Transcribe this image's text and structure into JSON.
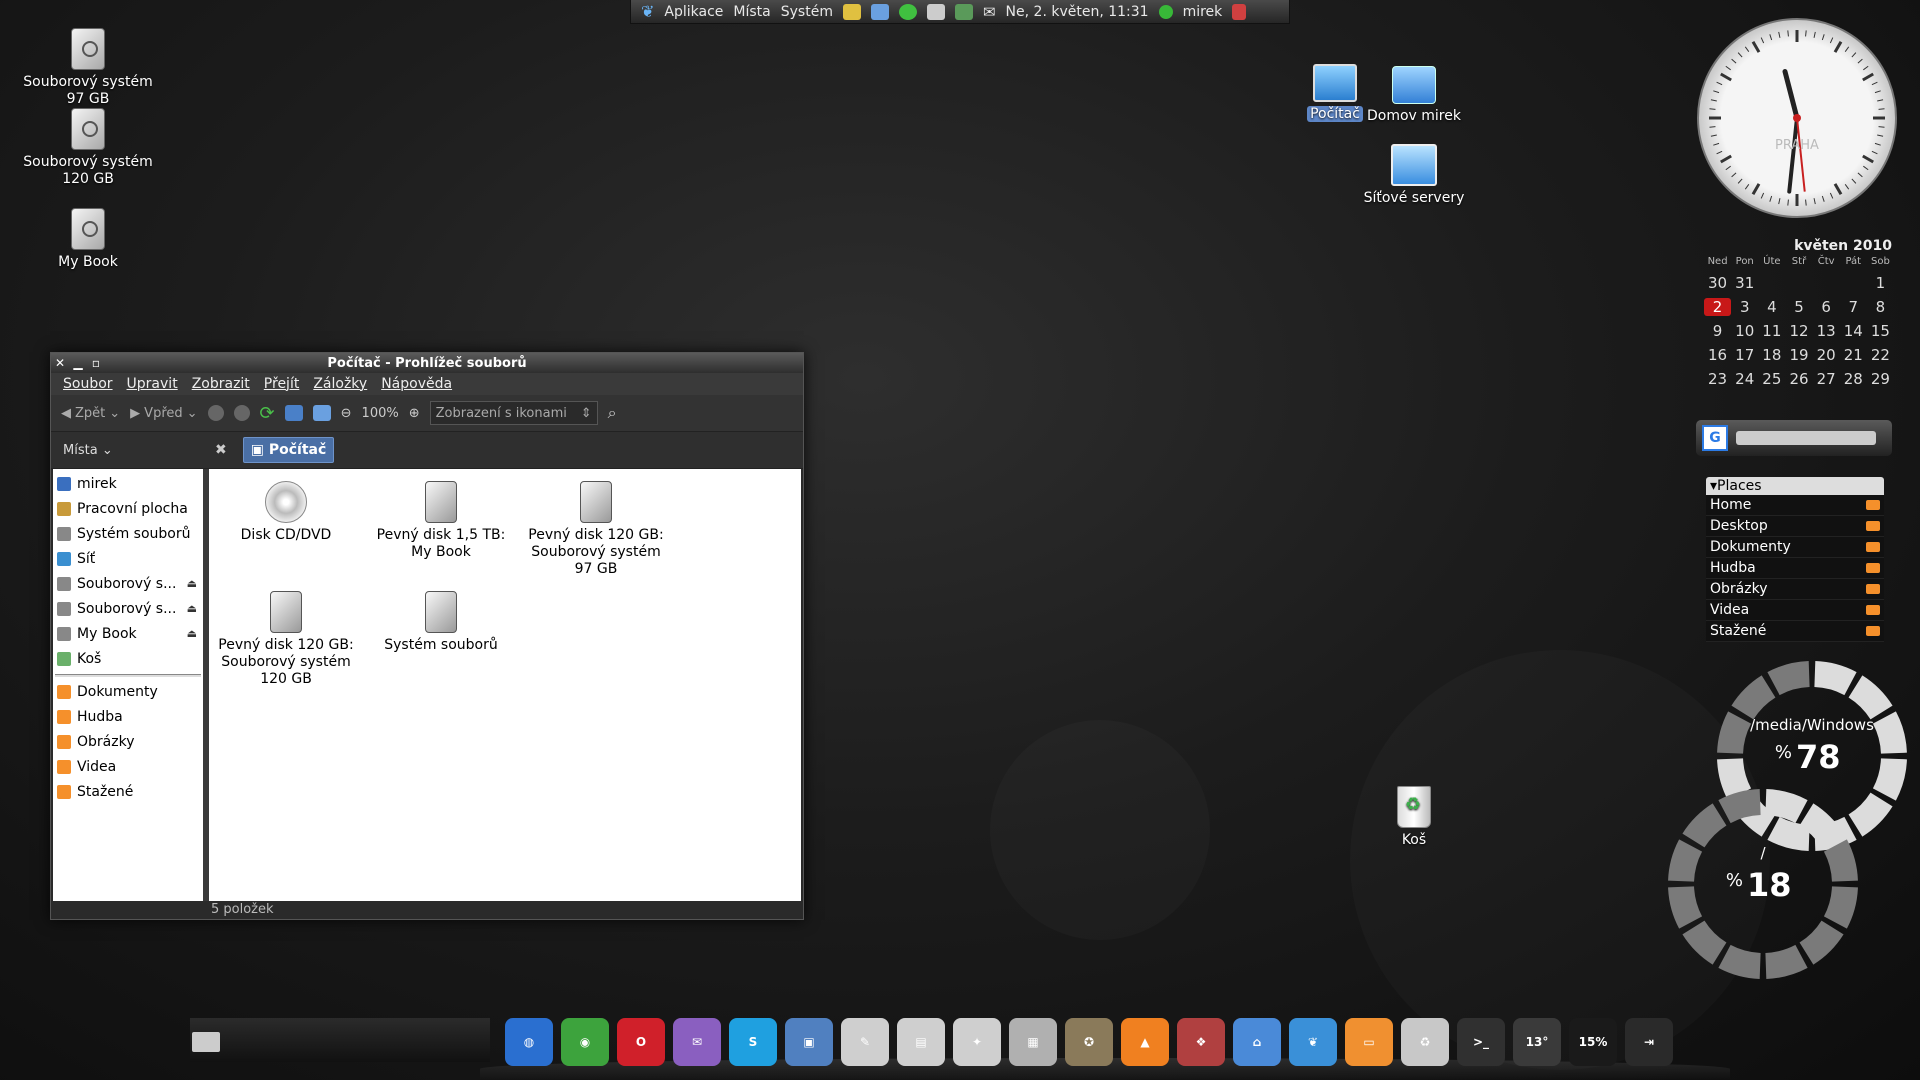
{
  "top_panel": {
    "apps": "Aplikace",
    "places": "Místa",
    "system": "Systém",
    "datetime": "Ne,  2. květen, 11:31",
    "user": "mirek"
  },
  "desktop_icons": [
    {
      "label": "Souborový systém\n97 GB"
    },
    {
      "label": "Souborový systém\n120 GB"
    },
    {
      "label": "My Book"
    },
    {
      "label": "Počítač"
    },
    {
      "label": "Domov mirek"
    },
    {
      "label": "Síťové servery"
    },
    {
      "label": "Koš"
    }
  ],
  "file_manager": {
    "title": "Počítač - Prohlížeč souborů",
    "menu": [
      "Soubor",
      "Upravit",
      "Zobrazit",
      "Přejít",
      "Záložky",
      "Nápověda"
    ],
    "toolbar": {
      "back": "Zpět",
      "forward": "Vpřed",
      "zoom": "100%",
      "view_mode": "Zobrazení s ikonami"
    },
    "places_label": "Místa",
    "location": "Počítač",
    "sidebar": [
      {
        "label": "mirek",
        "color": "#3a6fbf"
      },
      {
        "label": "Pracovní plocha",
        "color": "#c89a3a"
      },
      {
        "label": "Systém souborů",
        "color": "#888888"
      },
      {
        "label": "Síť",
        "color": "#3a8fd0"
      },
      {
        "label": "Souborový s...",
        "color": "#888888"
      },
      {
        "label": "Souborový s...",
        "color": "#888888"
      },
      {
        "label": "My Book",
        "color": "#888888"
      },
      {
        "label": "Koš",
        "color": "#6ab06a"
      }
    ],
    "bookmarks": [
      {
        "label": "Dokumenty"
      },
      {
        "label": "Hudba"
      },
      {
        "label": "Obrázky"
      },
      {
        "label": "Videa"
      },
      {
        "label": "Stažené"
      }
    ],
    "items": [
      {
        "label": "Disk CD/DVD"
      },
      {
        "label": "Pevný disk 1,5 TB:\nMy Book"
      },
      {
        "label": "Pevný disk 120 GB:\nSouborový systém\n97 GB"
      },
      {
        "label": "Pevný disk 120 GB:\nSouborový systém\n120 GB"
      },
      {
        "label": "Systém souborů"
      }
    ],
    "status": "5 položek"
  },
  "clock": {
    "city": "PRAHA",
    "hour": 11,
    "minute": 31
  },
  "calendar": {
    "title": "květen 2010",
    "weekdays": [
      "Ned",
      "Pon",
      "Úte",
      "Stř",
      "Čtv",
      "Pát",
      "Sob"
    ],
    "weeks": [
      [
        "30",
        "31",
        "",
        "",
        "",
        "",
        "1"
      ],
      [
        "2",
        "3",
        "4",
        "5",
        "6",
        "7",
        "8"
      ],
      [
        "9",
        "10",
        "11",
        "12",
        "13",
        "14",
        "15"
      ],
      [
        "16",
        "17",
        "18",
        "19",
        "20",
        "21",
        "22"
      ],
      [
        "23",
        "24",
        "25",
        "26",
        "27",
        "28",
        "29"
      ]
    ],
    "today": "2"
  },
  "places_widget": {
    "title": "▾Places",
    "items": [
      "Home",
      "Desktop",
      "Dokumenty",
      "Hudba",
      "Obrázky",
      "Videa",
      "Stažené"
    ]
  },
  "disk_widget": {
    "disks": [
      {
        "path": "/media/Windows",
        "percent": 78
      },
      {
        "path": "/",
        "percent": 18
      }
    ],
    "percent_sign": "%"
  },
  "dock": {
    "items": [
      {
        "name": "globe",
        "color": "#2a6fd0",
        "glyph": "◍"
      },
      {
        "name": "chrome",
        "color": "#3da33d",
        "glyph": "◉"
      },
      {
        "name": "opera",
        "color": "#d0202a",
        "glyph": "O"
      },
      {
        "name": "pidgin",
        "color": "#8a5fc0",
        "glyph": "✉"
      },
      {
        "name": "skype",
        "color": "#1fa0e0",
        "glyph": "S"
      },
      {
        "name": "virtualbox",
        "color": "#5080c0",
        "glyph": "▣"
      },
      {
        "name": "writer",
        "color": "#cfcfcf",
        "glyph": "✎"
      },
      {
        "name": "impress",
        "color": "#cfcfcf",
        "glyph": "▤"
      },
      {
        "name": "draw",
        "color": "#cfcfcf",
        "glyph": "✦"
      },
      {
        "name": "calculator",
        "color": "#b0b0b0",
        "glyph": "▦"
      },
      {
        "name": "gimp",
        "color": "#8a7a5a",
        "glyph": "✪"
      },
      {
        "name": "vlc",
        "color": "#f08020",
        "glyph": "▲"
      },
      {
        "name": "software-center",
        "color": "#b04040",
        "glyph": "❖"
      },
      {
        "name": "home-folder",
        "color": "#4a8ad8",
        "glyph": "⌂"
      },
      {
        "name": "gnome",
        "color": "#3a90d8",
        "glyph": "❦"
      },
      {
        "name": "folders",
        "color": "#f09030",
        "glyph": "▭"
      },
      {
        "name": "trash",
        "color": "#c8c8c8",
        "glyph": "♻"
      },
      {
        "name": "terminal",
        "color": "#303030",
        "glyph": ">_"
      },
      {
        "name": "weather",
        "color": "#3a3a3a",
        "glyph": "13°"
      },
      {
        "name": "cpu",
        "color": "#1a1a1a",
        "glyph": "15%"
      },
      {
        "name": "logout",
        "color": "#2a2a2a",
        "glyph": "⇥"
      }
    ]
  },
  "colors": {
    "accent": "#4a6fa5",
    "today": "#c81818"
  }
}
